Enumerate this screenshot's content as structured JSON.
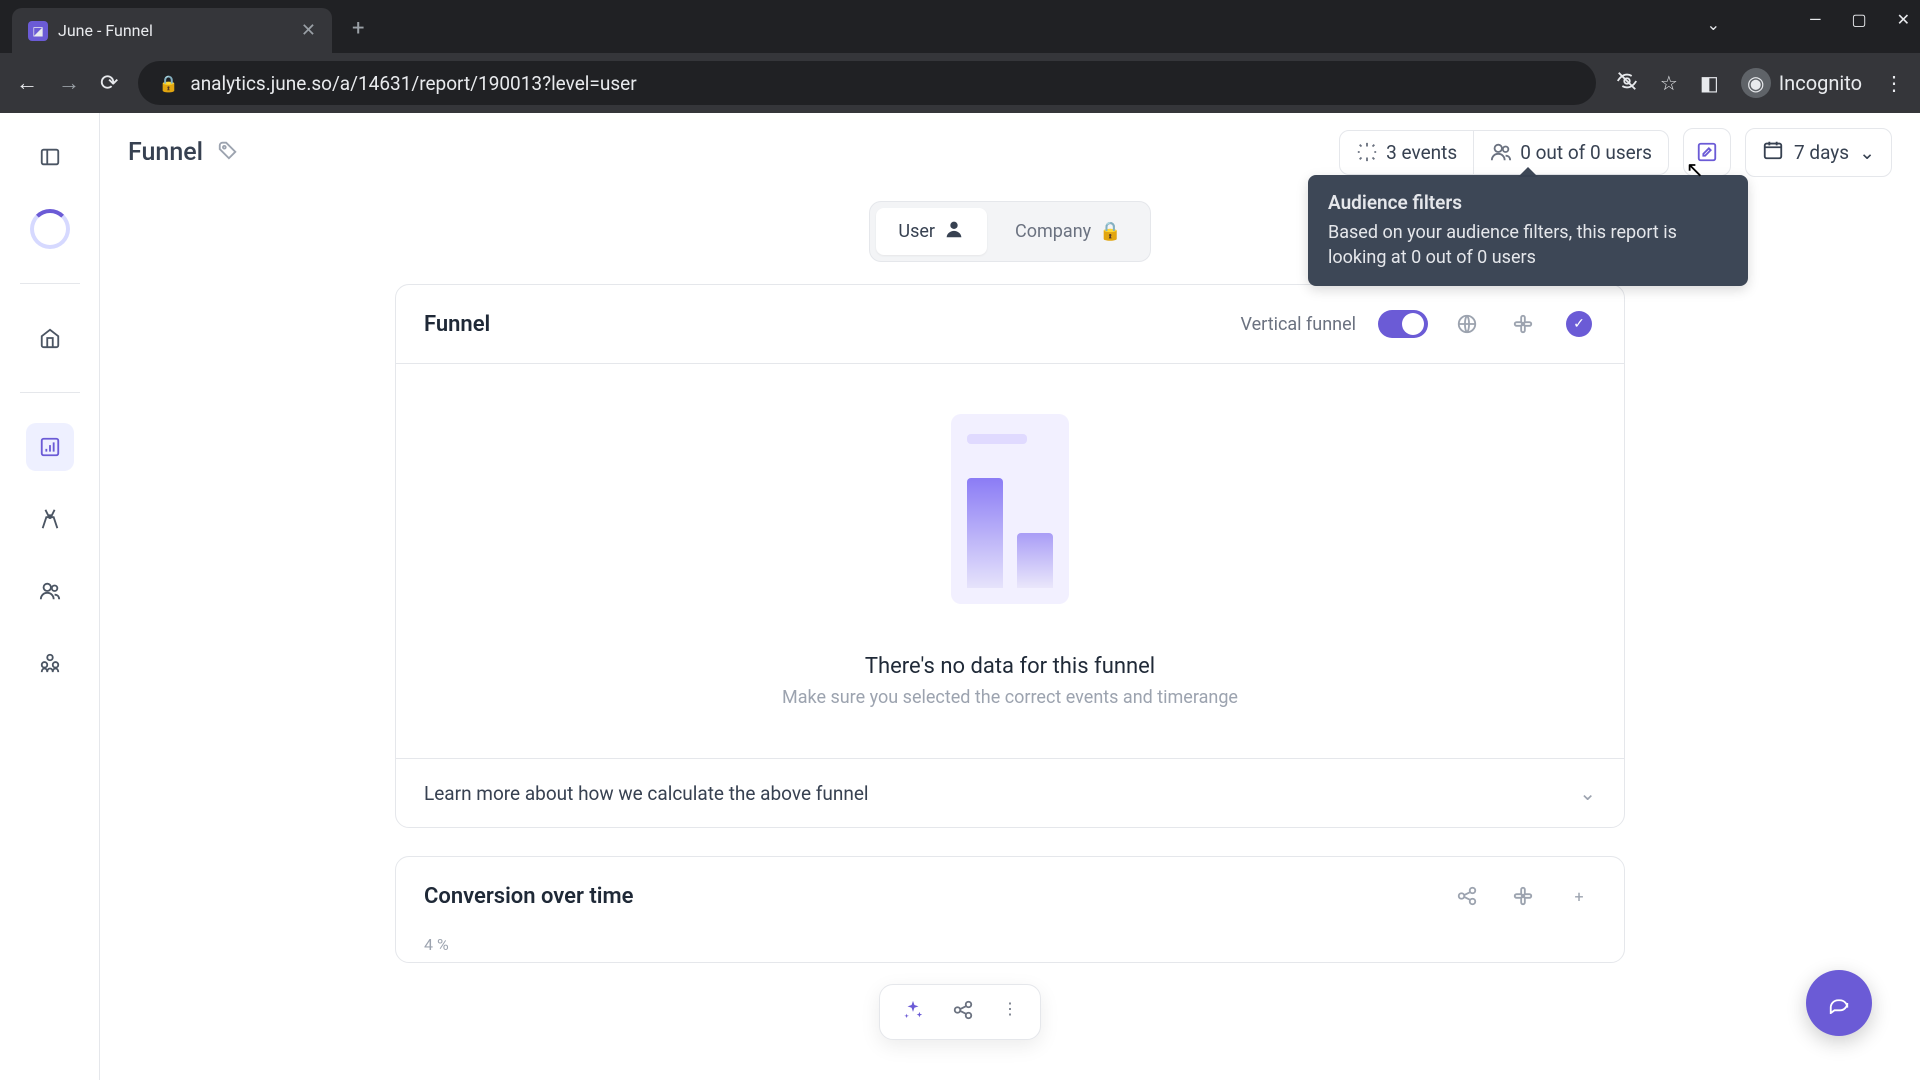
{
  "browser": {
    "tab_title": "June - Funnel",
    "url": "analytics.june.so/a/14631/report/190013?level=user",
    "incognito_label": "Incognito"
  },
  "header": {
    "page_title": "Funnel",
    "events": "3 events",
    "audience": "0 out of 0 users",
    "date_range": "7 days"
  },
  "tooltip": {
    "title": "Audience filters",
    "body": "Based on your audience filters, this report is looking at 0 out of 0 users"
  },
  "segment": {
    "user": "User",
    "company": "Company"
  },
  "funnel_card": {
    "title": "Funnel",
    "vertical_label": "Vertical funnel",
    "empty_title": "There's no data for this funnel",
    "empty_sub": "Make sure you selected the correct events and timerange",
    "learn_more": "Learn more about how we calculate the above funnel"
  },
  "conversion_card": {
    "title": "Conversion over time",
    "y_axis": "4 %"
  },
  "chart_data": {
    "type": "bar",
    "title": "Funnel",
    "categories": [],
    "values": [],
    "note": "no data"
  }
}
